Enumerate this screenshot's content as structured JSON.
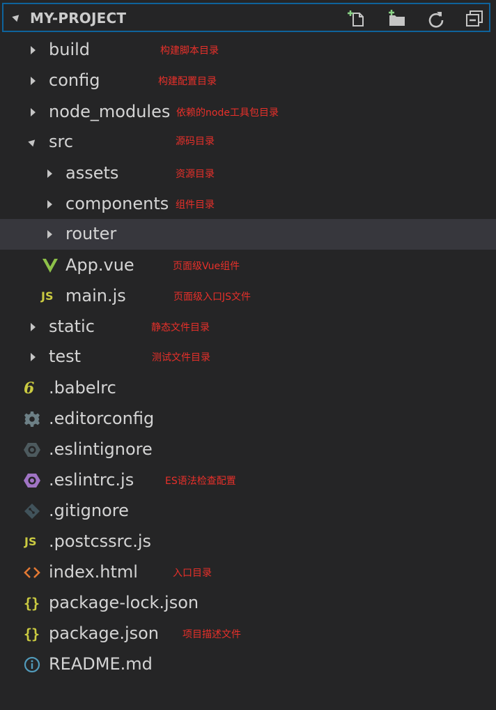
{
  "header": {
    "title": "MY-PROJECT",
    "new_file_icon": "new-file-icon",
    "new_folder_icon": "new-folder-icon",
    "refresh_icon": "refresh-icon",
    "collapse_icon": "collapse-all-icon"
  },
  "tree": [
    {
      "name": "build",
      "type": "folder",
      "expanded": false,
      "depth": 1,
      "note": "构建脚本目录"
    },
    {
      "name": "config",
      "type": "folder",
      "expanded": false,
      "depth": 1,
      "note": "构建配置目录"
    },
    {
      "name": "node_modules",
      "type": "folder",
      "expanded": false,
      "depth": 1,
      "note": "依赖的node工具包目录"
    },
    {
      "name": "src",
      "type": "folder",
      "expanded": true,
      "depth": 1,
      "note": "源码目录"
    },
    {
      "name": "assets",
      "type": "folder",
      "expanded": false,
      "depth": 2,
      "note": "资源目录"
    },
    {
      "name": "components",
      "type": "folder",
      "expanded": false,
      "depth": 2,
      "note": "组件目录"
    },
    {
      "name": "router",
      "type": "folder",
      "expanded": false,
      "depth": 2,
      "note": "",
      "selected": true
    },
    {
      "name": "App.vue",
      "type": "file",
      "icon": "vue-icon",
      "depth": 2,
      "note": "页面级Vue组件"
    },
    {
      "name": "main.js",
      "type": "file",
      "icon": "js-icon",
      "icon_text": "JS",
      "depth": 2,
      "note": "页面级入口JS文件"
    },
    {
      "name": "static",
      "type": "folder",
      "expanded": false,
      "depth": 1,
      "note": "静态文件目录"
    },
    {
      "name": "test",
      "type": "folder",
      "expanded": false,
      "depth": 1,
      "note": "测试文件目录"
    },
    {
      "name": ".babelrc",
      "type": "file",
      "icon": "babel-icon",
      "icon_text": "6",
      "depth": 1,
      "note": ""
    },
    {
      "name": ".editorconfig",
      "type": "file",
      "icon": "gear-icon",
      "depth": 1,
      "note": ""
    },
    {
      "name": ".eslintignore",
      "type": "file",
      "icon": "eslint-ignore-icon",
      "depth": 1,
      "note": ""
    },
    {
      "name": ".eslintrc.js",
      "type": "file",
      "icon": "eslint-icon",
      "depth": 1,
      "note": "ES语法检查配置"
    },
    {
      "name": ".gitignore",
      "type": "file",
      "icon": "git-icon",
      "depth": 1,
      "note": ""
    },
    {
      "name": ".postcssrc.js",
      "type": "file",
      "icon": "js-icon",
      "icon_text": "JS",
      "depth": 1,
      "note": ""
    },
    {
      "name": "index.html",
      "type": "file",
      "icon": "html-icon",
      "icon_text": "<>",
      "depth": 1,
      "note": "入口目录"
    },
    {
      "name": "package-lock.json",
      "type": "file",
      "icon": "json-icon",
      "icon_text": "{}",
      "depth": 1,
      "note": ""
    },
    {
      "name": "package.json",
      "type": "file",
      "icon": "json-icon",
      "icon_text": "{}",
      "depth": 1,
      "note": "项目描述文件"
    },
    {
      "name": "README.md",
      "type": "file",
      "icon": "info-icon",
      "depth": 1,
      "note": ""
    }
  ],
  "colors": {
    "background": "#252526",
    "selected_row": "#37373d",
    "focus_border": "#0e639c",
    "annotation": "#e8302a",
    "text": "#d4d4d4"
  }
}
